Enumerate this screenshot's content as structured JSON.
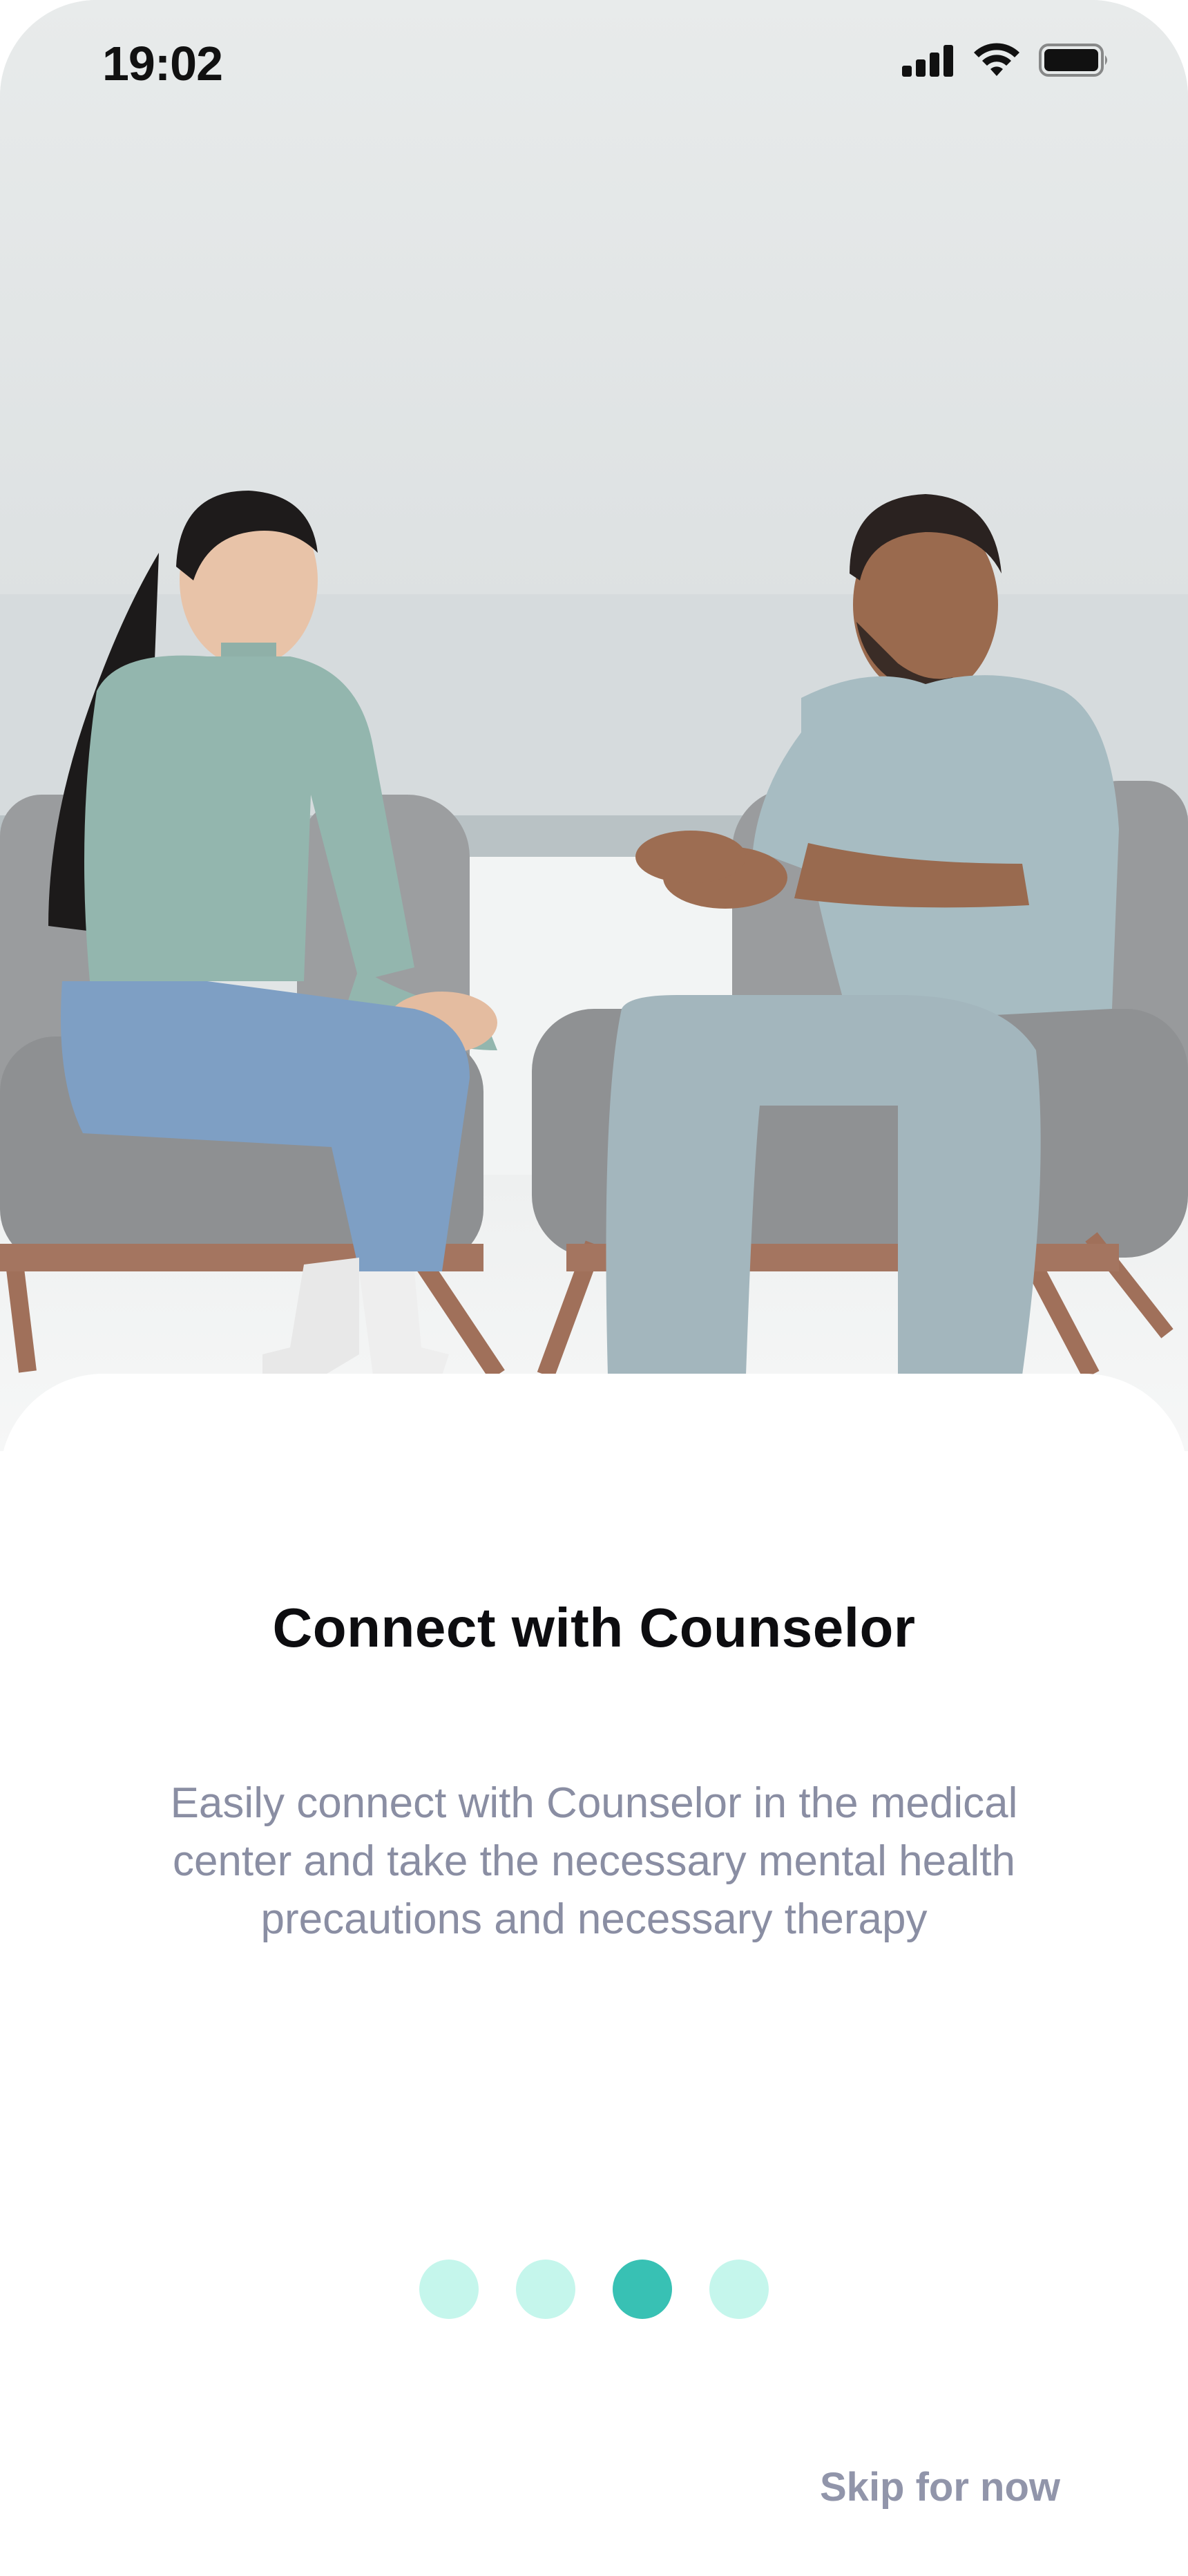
{
  "status_bar": {
    "time": "19:02",
    "icons": [
      "signal-icon",
      "wifi-icon",
      "battery-icon"
    ]
  },
  "hero": {
    "image": "counseling-photo"
  },
  "onboarding": {
    "title": "Connect with Counselor",
    "description": "Easily connect with Counselor in the medical\ncenter and take the necessary  mental health\nprecautions and  necessary therapy",
    "page_indicator": {
      "total": 4,
      "active_index": 2
    },
    "skip_label": "Skip for now"
  },
  "colors": {
    "accent": "#38c1b4",
    "dot_inactive": "#c5f6ec",
    "text_primary": "#0d0d10",
    "text_secondary": "#8a8ea3",
    "skip_text": "#9195aa"
  }
}
